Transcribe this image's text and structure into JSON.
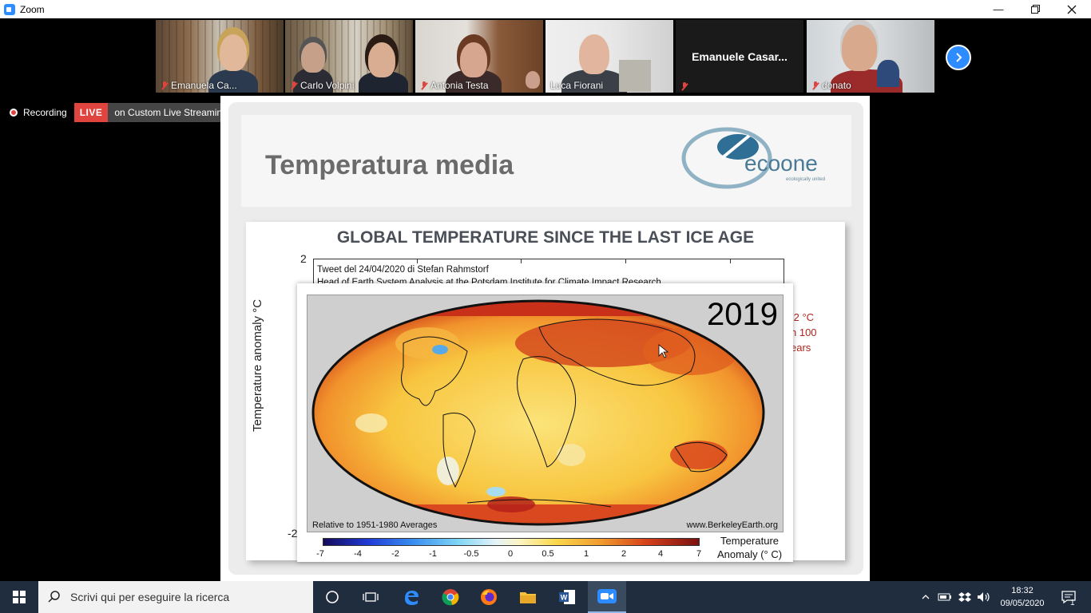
{
  "window": {
    "title": "Zoom",
    "minimize_icon": "minimize-icon",
    "restore_icon": "restore-icon",
    "close_icon": "close-icon"
  },
  "participants": [
    {
      "name": "Emanuela Ca...",
      "muted": true
    },
    {
      "name": "Carlo Volpini",
      "muted": true
    },
    {
      "name": "Antonia Testa",
      "muted": true
    },
    {
      "name": "Luca Fiorani",
      "muted": false,
      "active_speaker": true
    },
    {
      "name": "Emanuele  Casar...",
      "display_name": "Emanuele  Casar...",
      "muted": true,
      "video_off": true
    },
    {
      "name": "donato",
      "muted": true
    }
  ],
  "recording": {
    "label": "Recording",
    "live_badge": "LIVE",
    "service": "on Custom Live Streaming Service"
  },
  "slide": {
    "title": "Temperatura media",
    "logo_text": "ecoone",
    "logo_tagline": "ecologically united",
    "graph": {
      "heading": "GLOBAL TEMPERATURE SINCE THE LAST ICE AGE",
      "y_axis_label": "Temperature anomaly °C",
      "y_top_tick": "2",
      "y_bottom_tick": "-2",
      "tweet_line1": "Tweet del 24/04/2020 di Stefan Rahmstorf",
      "tweet_line2": "Head of Earth System Analysis at the Potsdam Institute  for Climate Impact Research",
      "side_note_lines": [
        ".2 °C",
        "n 100",
        "ears"
      ]
    },
    "map": {
      "year": "2019",
      "footer_left": "Relative to 1951-1980 Averages",
      "footer_right": "www.BerkeleyEarth.org",
      "colorbar_ticks": [
        "-7",
        "-4",
        "-2",
        "-1",
        "-0.5",
        "0",
        "0.5",
        "1",
        "2",
        "4",
        "7"
      ],
      "colorbar_unit_line1": "Temperature",
      "colorbar_unit_line2": "Anomaly (° C)"
    }
  },
  "taskbar": {
    "search_placeholder": "Scrivi qui per eseguire la ricerca",
    "time": "18:32",
    "date": "09/05/2020",
    "notification_count": "1"
  }
}
